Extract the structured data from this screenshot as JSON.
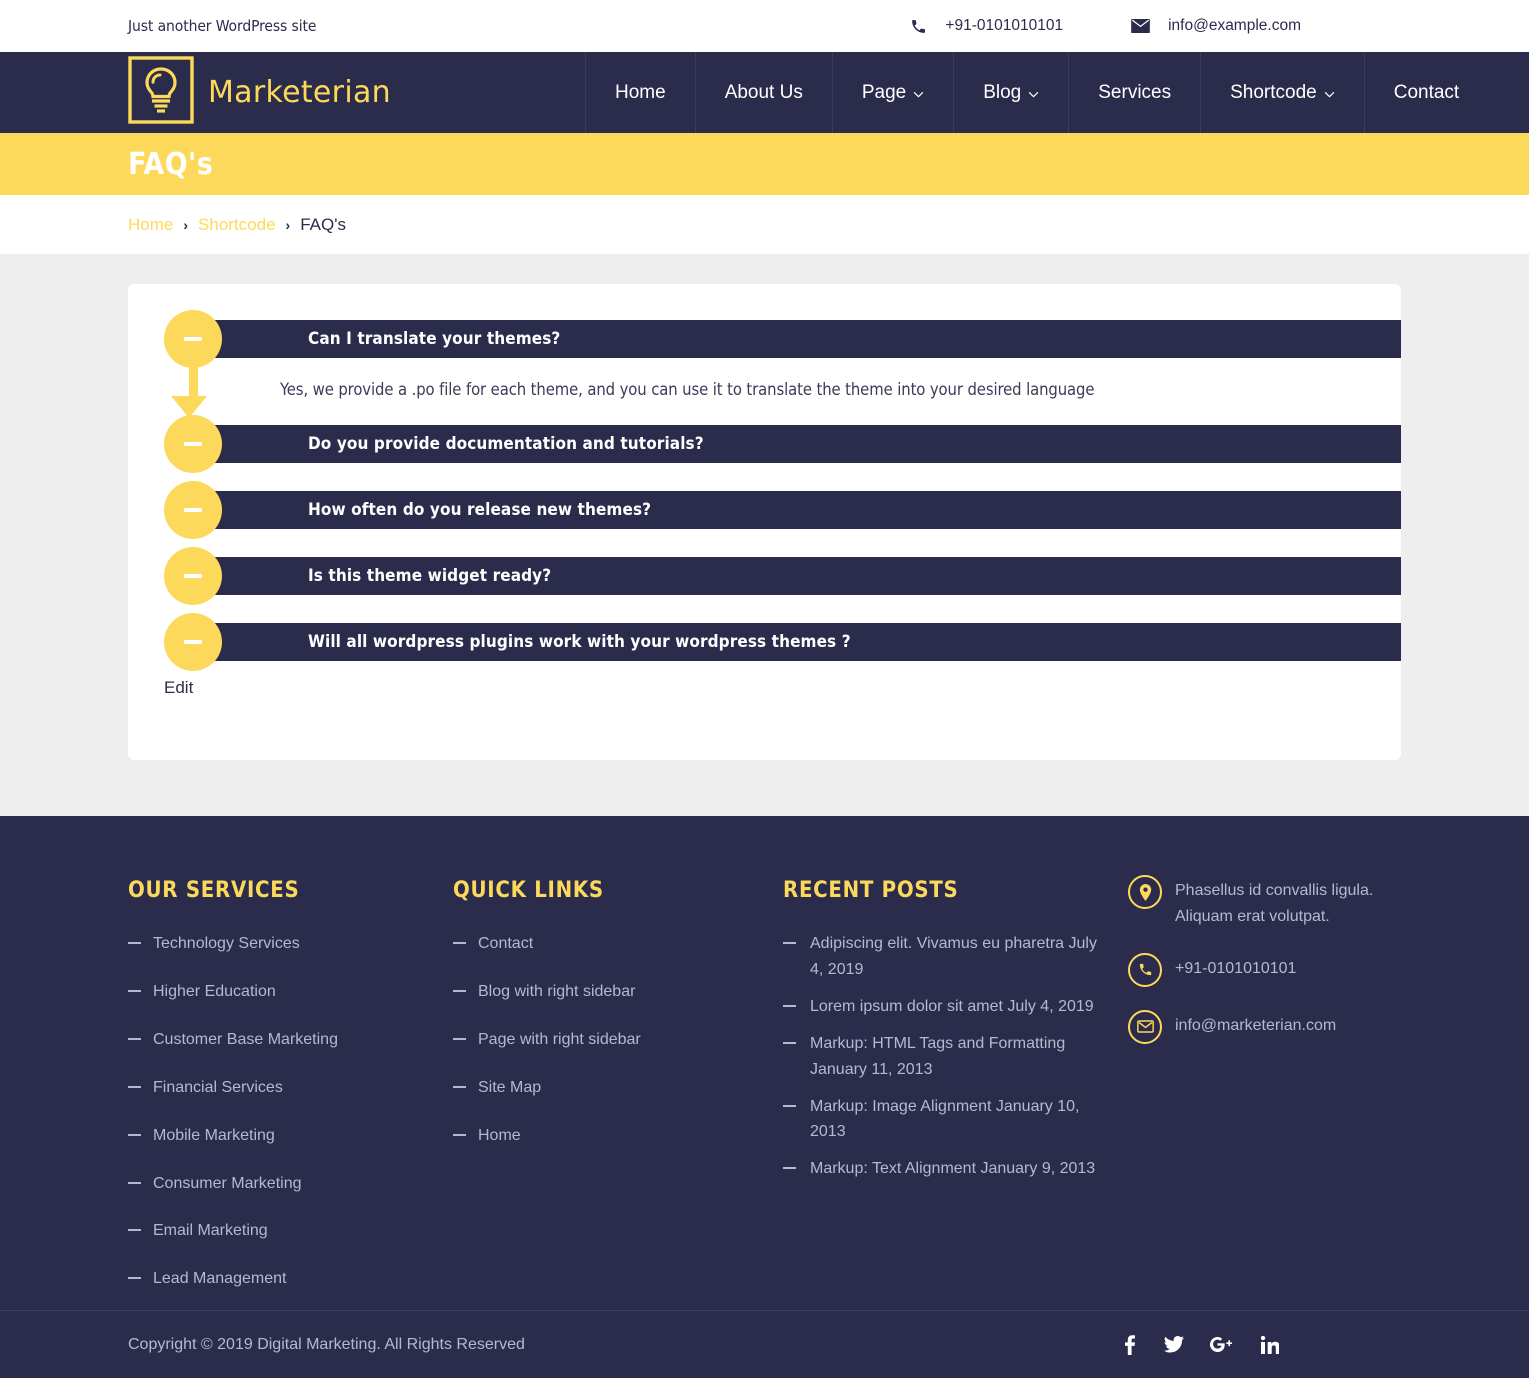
{
  "topbar": {
    "tagline": "Just another WordPress site",
    "phone": "+91-0101010101",
    "email": "info@example.com",
    "phone_icon": "phone-icon",
    "email_icon": "envelope-icon"
  },
  "header": {
    "logo_text": "Marketerian",
    "logo_icon": "lightbulb-logo-icon",
    "nav": [
      {
        "label": "Home",
        "has_caret": false
      },
      {
        "label": "About Us",
        "has_caret": false
      },
      {
        "label": "Page",
        "has_caret": true
      },
      {
        "label": "Blog",
        "has_caret": true
      },
      {
        "label": "Services",
        "has_caret": false
      },
      {
        "label": "Shortcode",
        "has_caret": true
      },
      {
        "label": "Contact",
        "has_caret": false
      }
    ],
    "caret": "⌄"
  },
  "banner": {
    "title": "FAQ's"
  },
  "breadcrumb": {
    "home": "Home",
    "sep": "›",
    "parent": "Shortcode",
    "current": "FAQ's"
  },
  "faq": {
    "items": [
      {
        "question": "Can I translate your themes?",
        "answer": "Yes, we provide a .po file for each theme, and you can use it to translate the theme into your desired language",
        "open": true
      },
      {
        "question": "Do you provide documentation and tutorials?",
        "answer": "",
        "open": false
      },
      {
        "question": "How often do you release new themes?",
        "answer": "",
        "open": false
      },
      {
        "question": "Is this theme widget ready?",
        "answer": "",
        "open": false
      },
      {
        "question": "Will all wordpress plugins work with your wordpress themes ?",
        "answer": "",
        "open": false
      }
    ],
    "edit_label": "Edit",
    "toggle_icon": "minus-icon"
  },
  "footer": {
    "services": {
      "title": "OUR SERVICES",
      "items": [
        "Technology Services",
        "Higher Education",
        "Customer Base Marketing",
        "Financial Services",
        "Mobile Marketing",
        "Consumer Marketing",
        "Email Marketing",
        "Lead Management"
      ]
    },
    "quick_links": {
      "title": "QUICK LINKS",
      "items": [
        "Contact",
        "Blog with right sidebar",
        "Page with right sidebar",
        "Site Map",
        "Home"
      ]
    },
    "recent_posts": {
      "title": "RECENT POSTS",
      "items": [
        "Adipiscing elit. Vivamus eu pharetra July 4, 2019",
        "Lorem ipsum dolor sit amet July 4, 2019",
        "Markup: HTML Tags and Formatting January 11, 2013",
        "Markup: Image Alignment January 10, 2013",
        "Markup: Text Alignment January 9, 2013"
      ]
    },
    "contact": {
      "address": "Phasellus id convallis ligula. Aliquam erat volutpat.",
      "phone": "+91-0101010101",
      "email": "info@marketerian.com",
      "address_icon": "map-pin-icon",
      "phone_icon": "phone-icon",
      "email_icon": "envelope-icon"
    }
  },
  "copyright": {
    "text": "Copyright © 2019 Digital Marketing. All Rights Reserved",
    "socials": [
      {
        "name": "facebook-icon",
        "glyph": "f"
      },
      {
        "name": "twitter-icon",
        "glyph": ""
      },
      {
        "name": "google-plus-icon",
        "glyph": "G+"
      },
      {
        "name": "linkedin-icon",
        "glyph": "in"
      }
    ]
  },
  "colors": {
    "accent_yellow": "#fcd95b",
    "navy": "#2b2c4c",
    "page_bg": "#eeeeee",
    "muted_text": "#b6b9cd"
  }
}
